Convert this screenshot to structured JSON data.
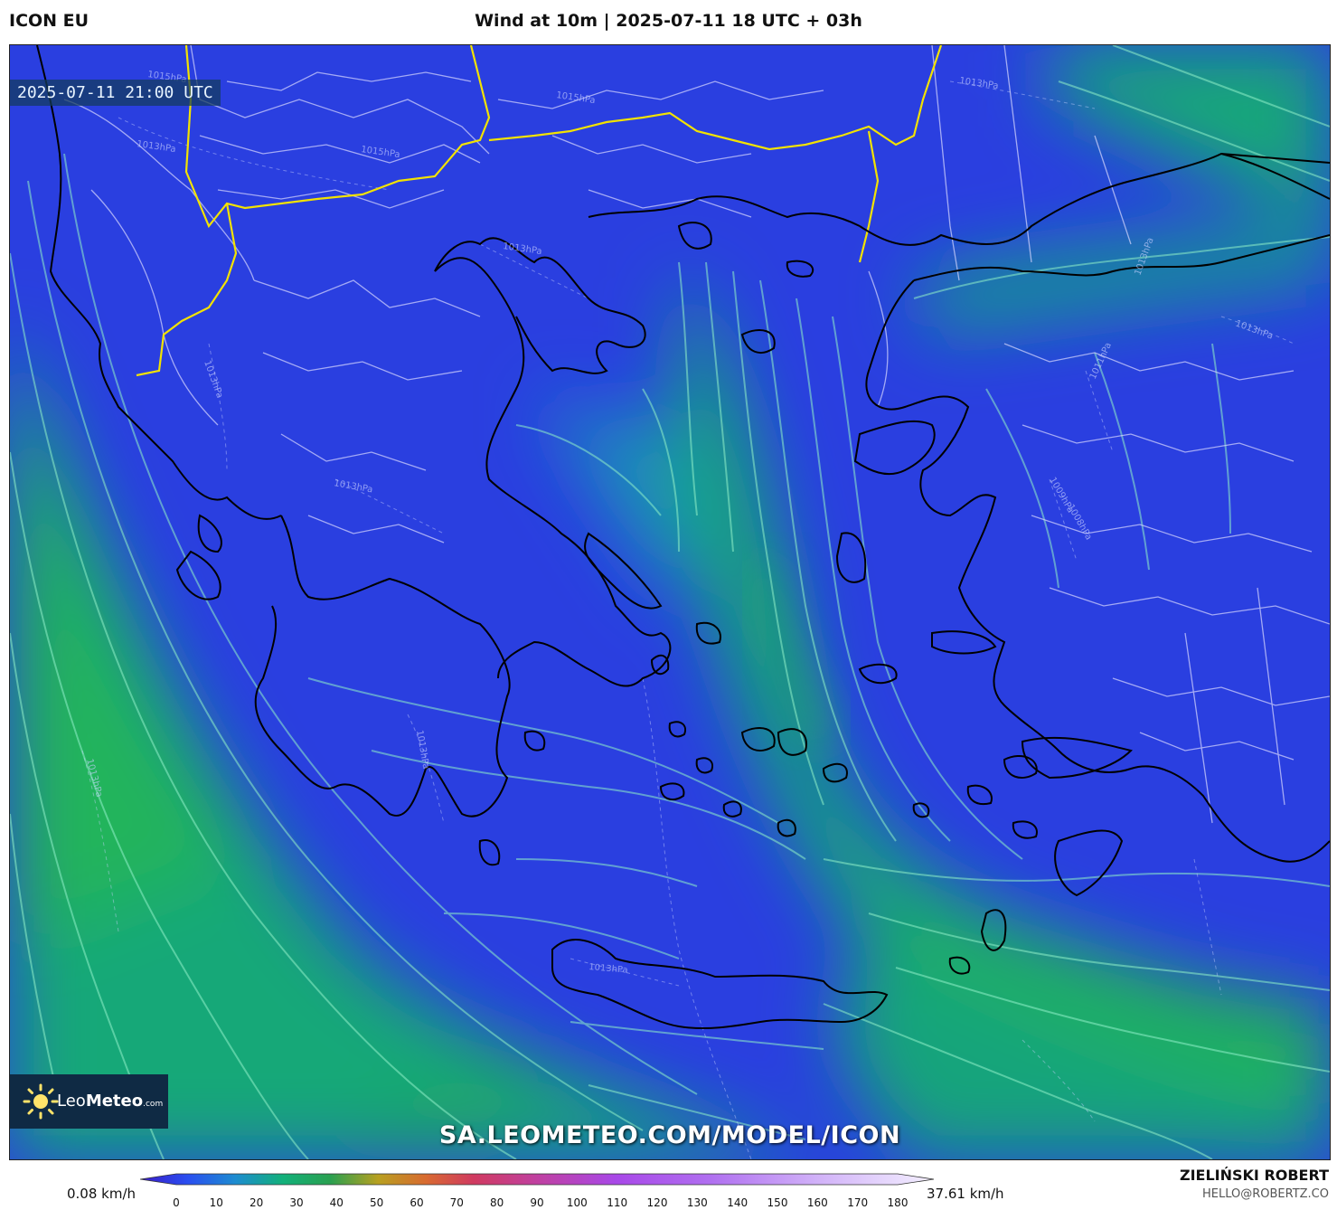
{
  "header": {
    "model": "ICON EU",
    "title": "Wind at 10m | 2025-07-11 18 UTC + 03h"
  },
  "map": {
    "timestamp": "2025-07-11 21:00 UTC",
    "watermark": "SA.LEOMETEO.COM/MODEL/ICON",
    "logo": {
      "brand_light": "Leo",
      "brand_bold": "Meteo",
      "brand_suffix": ".com"
    },
    "isobar_labels": [
      "1015hPa",
      "1013hPa",
      "1015hPa",
      "1013hPa",
      "1015hPa",
      "1013hPa",
      "1013hPa",
      "1013hPa",
      "1011hPa",
      "1013hPa",
      "1009hPa",
      "1008hPa",
      "1013hPa",
      "1013hPa",
      "1013hPa",
      "1013hPa"
    ],
    "colors": {
      "calm": "#2a3fe0",
      "moderate": "#1aa875",
      "strong": "#1fb06a",
      "coast": "#000000",
      "border": "#d8d8ff",
      "country_border": "#f2e200",
      "streamline": "#8ff0c8"
    }
  },
  "legend": {
    "min_label": "0.08 km/h",
    "max_label": "37.61 km/h",
    "ticks": [
      "0",
      "10",
      "20",
      "30",
      "40",
      "50",
      "60",
      "70",
      "80",
      "90",
      "100",
      "110",
      "120",
      "130",
      "140",
      "150",
      "160",
      "170",
      "180"
    ],
    "gradient": [
      "#3a1cc8",
      "#2a4ef0",
      "#1d8cd0",
      "#12b07a",
      "#2aa050",
      "#b8a020",
      "#d86a30",
      "#d03a60",
      "#c040a0",
      "#a848e8",
      "#b070f0",
      "#d0b0f8",
      "#f4f0ff"
    ]
  },
  "credit": {
    "name": "ZIELIŃSKI ROBERT",
    "email": "HELLO@ROBERTZ.CO"
  }
}
